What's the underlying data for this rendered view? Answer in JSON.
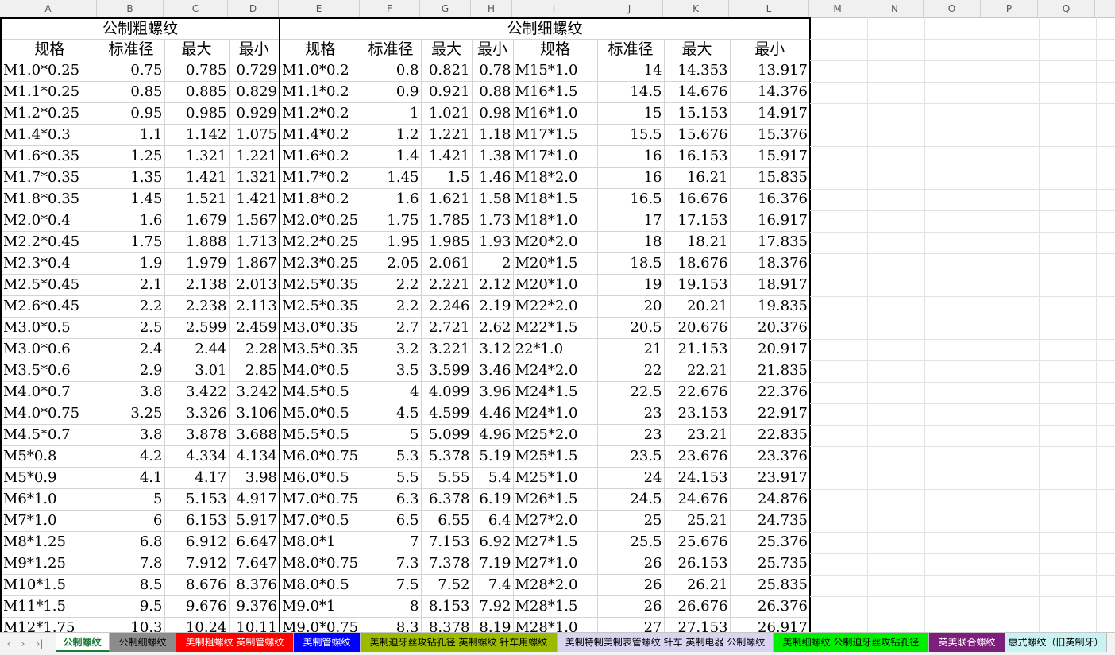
{
  "columns": [
    "A",
    "B",
    "C",
    "D",
    "E",
    "F",
    "G",
    "H",
    "I",
    "J",
    "K",
    "L",
    "M",
    "N",
    "O",
    "P",
    "Q"
  ],
  "coarse": {
    "title": "公制粗螺纹",
    "headers": [
      "规格",
      "标准径",
      "最大",
      "最小"
    ],
    "rows": [
      [
        "M1.0*0.25",
        "0.75",
        "0.785",
        "0.729"
      ],
      [
        "M1.1*0.25",
        "0.85",
        "0.885",
        "0.829"
      ],
      [
        "M1.2*0.25",
        "0.95",
        "0.985",
        "0.929"
      ],
      [
        "M1.4*0.3",
        "1.1",
        "1.142",
        "1.075"
      ],
      [
        "M1.6*0.35",
        "1.25",
        "1.321",
        "1.221"
      ],
      [
        "M1.7*0.35",
        "1.35",
        "1.421",
        "1.321"
      ],
      [
        "M1.8*0.35",
        "1.45",
        "1.521",
        "1.421"
      ],
      [
        "M2.0*0.4",
        "1.6",
        "1.679",
        "1.567"
      ],
      [
        "M2.2*0.45",
        "1.75",
        "1.888",
        "1.713"
      ],
      [
        "M2.3*0.4",
        "1.9",
        "1.979",
        "1.867"
      ],
      [
        "M2.5*0.45",
        "2.1",
        "2.138",
        "2.013"
      ],
      [
        "M2.6*0.45",
        "2.2",
        "2.238",
        "2.113"
      ],
      [
        "M3.0*0.5",
        "2.5",
        "2.599",
        "2.459"
      ],
      [
        "M3.0*0.6",
        "2.4",
        "2.44",
        "2.28"
      ],
      [
        "M3.5*0.6",
        "2.9",
        "3.01",
        "2.85"
      ],
      [
        "M4.0*0.7",
        "3.8",
        "3.422",
        "3.242"
      ],
      [
        "M4.0*0.75",
        "3.25",
        "3.326",
        "3.106"
      ],
      [
        "M4.5*0.7",
        "3.8",
        "3.878",
        "3.688"
      ],
      [
        "M5*0.8",
        "4.2",
        "4.334",
        "4.134"
      ],
      [
        "M5*0.9",
        "4.1",
        "4.17",
        "3.98"
      ],
      [
        "M6*1.0",
        "5",
        "5.153",
        "4.917"
      ],
      [
        "M7*1.0",
        "6",
        "6.153",
        "5.917"
      ],
      [
        "M8*1.25",
        "6.8",
        "6.912",
        "6.647"
      ],
      [
        "M9*1.25",
        "7.8",
        "7.912",
        "7.647"
      ],
      [
        "M10*1.5",
        "8.5",
        "8.676",
        "8.376"
      ],
      [
        "M11*1.5",
        "9.5",
        "9.676",
        "9.376"
      ],
      [
        "M12*1.75",
        "10.3",
        "10.24",
        "10.11"
      ]
    ]
  },
  "fine": {
    "title": "公制细螺纹",
    "headers": [
      "规格",
      "标准径",
      "最大",
      "最小",
      "规格",
      "标准径",
      "最大",
      "最小"
    ],
    "rows": [
      [
        "M1.0*0.2",
        "0.8",
        "0.821",
        "0.78",
        "M15*1.0",
        "14",
        "14.353",
        "13.917"
      ],
      [
        "M1.1*0.2",
        "0.9",
        "0.921",
        "0.88",
        "M16*1.5",
        "14.5",
        "14.676",
        "14.376"
      ],
      [
        "M1.2*0.2",
        "1",
        "1.021",
        "0.98",
        "M16*1.0",
        "15",
        "15.153",
        "14.917"
      ],
      [
        "M1.4*0.2",
        "1.2",
        "1.221",
        "1.18",
        "M17*1.5",
        "15.5",
        "15.676",
        "15.376"
      ],
      [
        "M1.6*0.2",
        "1.4",
        "1.421",
        "1.38",
        "M17*1.0",
        "16",
        "16.153",
        "15.917"
      ],
      [
        "M1.7*0.2",
        "1.45",
        "1.5",
        "1.46",
        "M18*2.0",
        "16",
        "16.21",
        "15.835"
      ],
      [
        "M1.8*0.2",
        "1.6",
        "1.621",
        "1.58",
        "M18*1.5",
        "16.5",
        "16.676",
        "16.376"
      ],
      [
        "M2.0*0.25",
        "1.75",
        "1.785",
        "1.73",
        "M18*1.0",
        "17",
        "17.153",
        "16.917"
      ],
      [
        "M2.2*0.25",
        "1.95",
        "1.985",
        "1.93",
        "M20*2.0",
        "18",
        "18.21",
        "17.835"
      ],
      [
        "M2.3*0.25",
        "2.05",
        "2.061",
        "2",
        "M20*1.5",
        "18.5",
        "18.676",
        "18.376"
      ],
      [
        "M2.5*0.35",
        "2.2",
        "2.221",
        "2.12",
        "M20*1.0",
        "19",
        "19.153",
        "18.917"
      ],
      [
        "M2.5*0.35",
        "2.2",
        "2.246",
        "2.19",
        "M22*2.0",
        "20",
        "20.21",
        "19.835"
      ],
      [
        "M3.0*0.35",
        "2.7",
        "2.721",
        "2.62",
        "M22*1.5",
        "20.5",
        "20.676",
        "20.376"
      ],
      [
        "M3.5*0.35",
        "3.2",
        "3.221",
        "3.12",
        "22*1.0",
        "21",
        "21.153",
        "20.917"
      ],
      [
        "M4.0*0.5",
        "3.5",
        "3.599",
        "3.46",
        "M24*2.0",
        "22",
        "22.21",
        "21.835"
      ],
      [
        "M4.5*0.5",
        "4",
        "4.099",
        "3.96",
        "M24*1.5",
        "22.5",
        "22.676",
        "22.376"
      ],
      [
        "M5.0*0.5",
        "4.5",
        "4.599",
        "4.46",
        "M24*1.0",
        "23",
        "23.153",
        "22.917"
      ],
      [
        "M5.5*0.5",
        "5",
        "5.099",
        "4.96",
        "M25*2.0",
        "23",
        "23.21",
        "22.835"
      ],
      [
        "M6.0*0.75",
        "5.3",
        "5.378",
        "5.19",
        "M25*1.5",
        "23.5",
        "23.676",
        "23.376"
      ],
      [
        "M6.0*0.5",
        "5.5",
        "5.55",
        "5.4",
        "M25*1.0",
        "24",
        "24.153",
        "23.917"
      ],
      [
        "M7.0*0.75",
        "6.3",
        "6.378",
        "6.19",
        "M26*1.5",
        "24.5",
        "24.676",
        "24.876"
      ],
      [
        "M7.0*0.5",
        "6.5",
        "6.55",
        "6.4",
        "M27*2.0",
        "25",
        "25.21",
        "24.735"
      ],
      [
        "M8.0*1",
        "7",
        "7.153",
        "6.92",
        "M27*1.5",
        "25.5",
        "25.676",
        "25.376"
      ],
      [
        "M8.0*0.75",
        "7.3",
        "7.378",
        "7.19",
        "M27*1.0",
        "26",
        "26.153",
        "25.735"
      ],
      [
        "M8.0*0.5",
        "7.5",
        "7.52",
        "7.4",
        "M28*2.0",
        "26",
        "26.21",
        "25.835"
      ],
      [
        "M9.0*1",
        "8",
        "8.153",
        "7.92",
        "M28*1.5",
        "26",
        "26.676",
        "26.376"
      ],
      [
        "M9.0*0.75",
        "8.3",
        "8.378",
        "8.19",
        "M28*1.0",
        "27",
        "27.153",
        "26.917"
      ]
    ]
  },
  "nav": {
    "prev": "‹",
    "next": "›",
    "last": "›|"
  },
  "tabs": [
    {
      "label": "公制螺纹",
      "bg": "#ffffff",
      "fg": "#1b7a3a",
      "active": true
    },
    {
      "label": "公制细螺纹",
      "bg": "#8c8c8c",
      "fg": "#000000"
    },
    {
      "label": "美制粗螺纹 英制管螺纹",
      "bg": "#ff0000",
      "fg": "#ffffff"
    },
    {
      "label": "美制管螺纹",
      "bg": "#0000ff",
      "fg": "#ffffff"
    },
    {
      "label": "美制迫牙丝攻钻孔径 英制螺纹 针车用螺纹",
      "bg": "#9bbb00",
      "fg": "#000000"
    },
    {
      "label": "美制特制美制表管螺纹 针车 英制电器 公制螺纹",
      "bg": "#d9d4f0",
      "fg": "#000000"
    },
    {
      "label": "美制细螺纹 公制迫牙丝攻钻孔径",
      "bg": "#00ee00",
      "fg": "#000000"
    },
    {
      "label": "英美联合螺纹",
      "bg": "#7b1f7b",
      "fg": "#ffffff"
    },
    {
      "label": "惠式螺纹（旧英制牙）",
      "bg": "#c9f3f3",
      "fg": "#000000"
    }
  ]
}
